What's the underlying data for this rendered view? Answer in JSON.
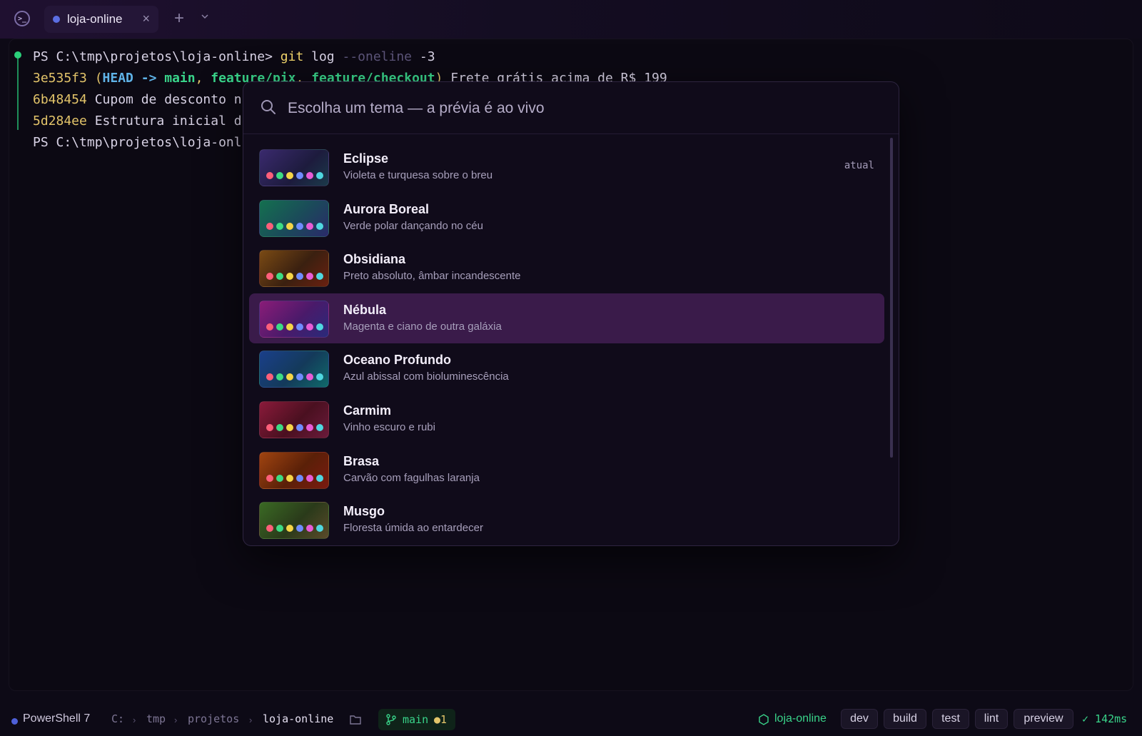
{
  "colors": {
    "accent": "#3a1b4a",
    "branch_green": "#39d48a",
    "hash_yellow": "#e3c46a",
    "head_blue": "#5fb3e8"
  },
  "titlebar": {
    "app_icon": "powershell-icon",
    "tab": {
      "label": "loja-online",
      "close": "×"
    },
    "new_tab": "+",
    "dropdown_icon": "chevron-down-icon"
  },
  "terminal": {
    "lines": [
      {
        "prompt": "PS C:\\tmp\\projetos\\loja-online> ",
        "cmd": "git",
        "arg1": " log ",
        "flag": "--oneline",
        "arg2": " -3"
      },
      {
        "hash": "3e535f3",
        "open": " (",
        "head": "HEAD -> ",
        "branch1": "main",
        "sep1": ", ",
        "branch2": "feature/pix",
        "sep2": ", ",
        "branch3": "feature/checkout",
        "close": ")",
        "msg": " Frete grátis acima de R$ 199"
      },
      {
        "hash": "6b48454",
        "msg": " Cupom de desconto n"
      },
      {
        "hash": "5d284ee",
        "msg": " Estrutura inicial d"
      },
      {
        "prompt": "PS C:\\tmp\\projetos\\loja-onl"
      }
    ]
  },
  "palette": {
    "search_placeholder": "Escolha um tema — a prévia é ao vivo",
    "themes": [
      {
        "name": "Eclipse",
        "desc": "Violeta e turquesa sobre o breu",
        "badge": "atual",
        "bg": "linear-gradient(135deg,#3a2a6e,#1d1b3d 60%,#1b3a4a)",
        "selected": false
      },
      {
        "name": "Aurora Boreal",
        "desc": "Verde polar dançando no céu",
        "badge": "",
        "bg": "linear-gradient(135deg,#14704f,#1b4a5a 55%,#2a2a6a)",
        "selected": false
      },
      {
        "name": "Obsidiana",
        "desc": "Preto absoluto, âmbar incandescente",
        "badge": "",
        "bg": "linear-gradient(135deg,#7a4a14,#3a2010 55%,#6a2010)",
        "selected": false
      },
      {
        "name": "Nébula",
        "desc": "Magenta e ciano de outra galáxia",
        "badge": "",
        "bg": "linear-gradient(135deg,#8a1c78,#4a1a6a 55%,#2a2a7a)",
        "selected": true
      },
      {
        "name": "Oceano Profundo",
        "desc": "Azul abissal com bioluminescência",
        "badge": "",
        "bg": "linear-gradient(135deg,#1a3f8a,#143a5a 55%,#0f6a6a)",
        "selected": false
      },
      {
        "name": "Carmim",
        "desc": "Vinho escuro e rubi",
        "badge": "",
        "bg": "linear-gradient(135deg,#8a1a3a,#4a1020 55%,#6a1a3a)",
        "selected": false
      },
      {
        "name": "Brasa",
        "desc": "Carvão com fagulhas laranja",
        "badge": "",
        "bg": "linear-gradient(135deg,#a04410,#5a2008 55%,#7a1a10)",
        "selected": false
      },
      {
        "name": "Musgo",
        "desc": "Floresta úmida ao entardecer",
        "badge": "",
        "bg": "linear-gradient(135deg,#3a6a24,#2a3a1a 55%,#5a4a2a)",
        "selected": false
      }
    ],
    "dot_colors": [
      "#ff5f7a",
      "#3ddc84",
      "#f5d547",
      "#6f8cff",
      "#e75cd6",
      "#4fd8e0"
    ]
  },
  "statusbar": {
    "shell": "PowerShell 7",
    "path": [
      "C:",
      "tmp",
      "projetos",
      "loja-online"
    ],
    "branch": "main",
    "dirty": "●1",
    "project": "loja-online",
    "scripts": [
      "dev",
      "build",
      "test",
      "lint",
      "preview"
    ],
    "timing": "✓ 142ms"
  }
}
